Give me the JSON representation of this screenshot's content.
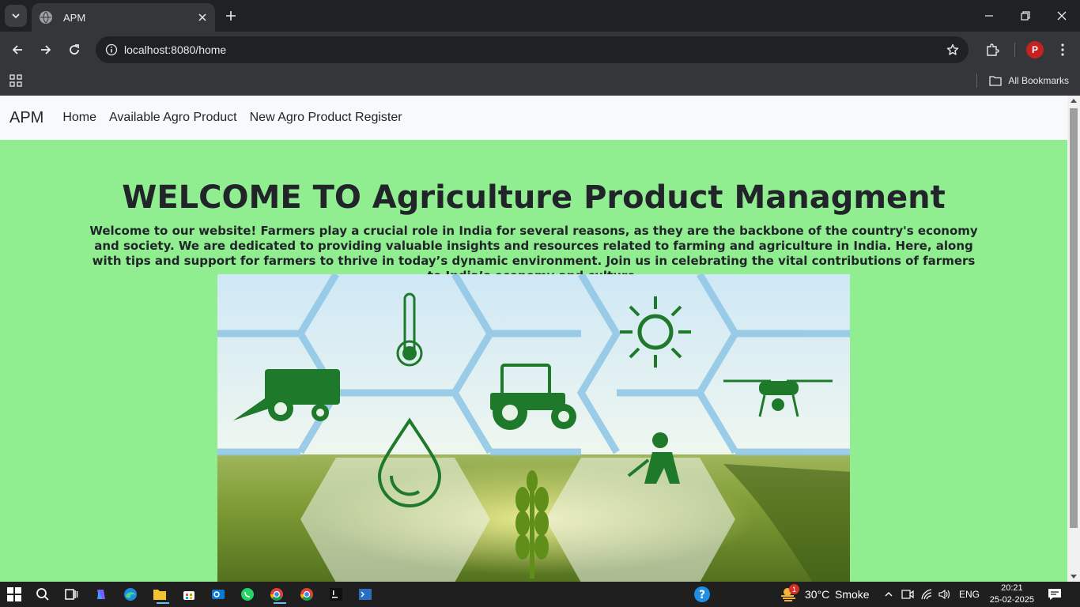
{
  "browser": {
    "tab_title": "APM",
    "url_host": "localhost",
    "url_rest": ":8080/home",
    "bookmarks_label": "All Bookmarks",
    "profile_initial": "P"
  },
  "site": {
    "brand": "APM",
    "nav": [
      {
        "label": "Home"
      },
      {
        "label": "Available Agro Product"
      },
      {
        "label": "New Agro Product Register"
      }
    ],
    "title": "WELCOME TO Agriculture Product Managment",
    "intro": "Welcome to our website! Farmers play a crucial role in India for several reasons, as they are the backbone of the country's economy and society. We are dedicated to providing valuable insights and resources related to farming and agriculture in India. Here, along with tips and support for farmers to thrive in today’s dynamic environment. Join us in celebrating the vital contributions of farmers to India’s economy and culture."
  },
  "taskbar": {
    "weather_temp": "30°C",
    "weather_cond": "Smoke",
    "weather_badge": "1",
    "language": "ENG",
    "time": "20:21",
    "date": "25-02-2025"
  },
  "colors": {
    "page_bg": "#90ee90",
    "navbar_bg": "#f8f9fa",
    "chrome_dark": "#202124",
    "chrome_toolbar": "#35363a"
  }
}
